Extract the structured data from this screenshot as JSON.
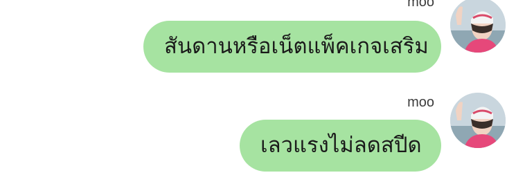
{
  "messages": [
    {
      "sender": "moo",
      "text": "สันดานหรือเน็ตแพ็คเกจเสริม",
      "avatar_icon": "user-avatar-photo"
    },
    {
      "sender": "moo",
      "text": "เลวแรงไม่ลดสปีด",
      "avatar_icon": "user-avatar-photo"
    }
  ],
  "colors": {
    "bubble": "#a6e3a1",
    "text": "#1a1a1a",
    "sender": "#3c3c3c"
  }
}
